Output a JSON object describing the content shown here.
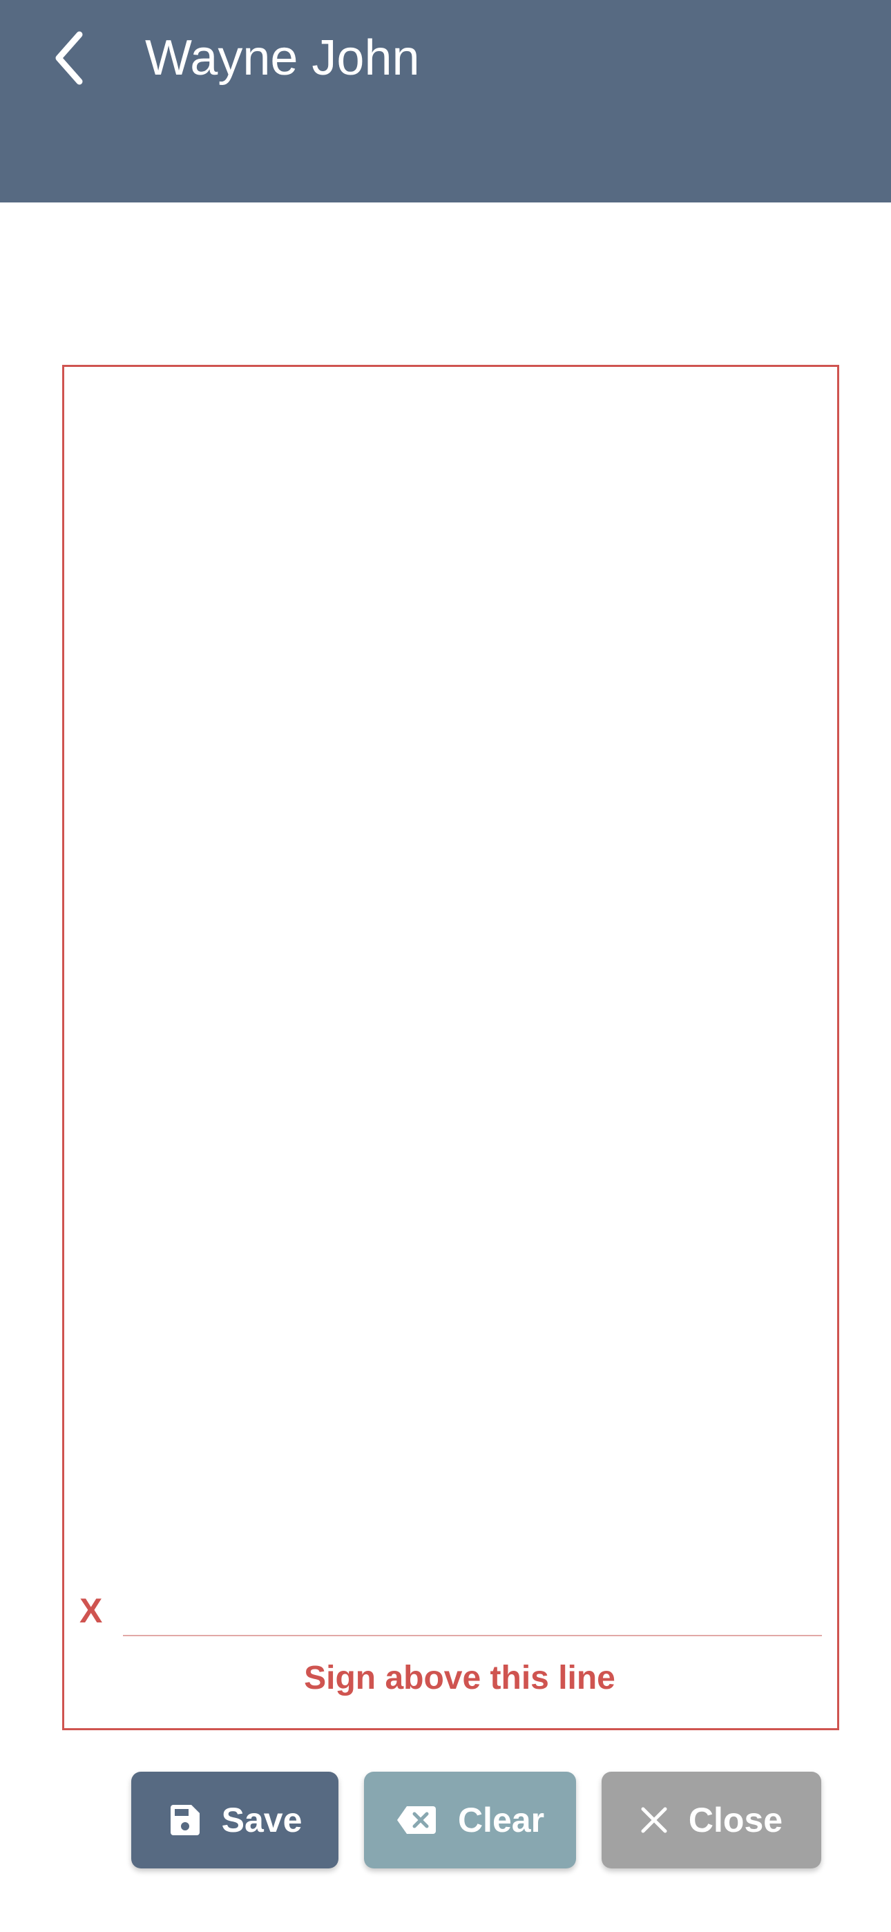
{
  "header": {
    "title": "Wayne John",
    "back_icon": "chevron-left-icon",
    "background_color": "#576a82"
  },
  "signature": {
    "x_mark": "X",
    "caption": "Sign above this line",
    "accent_color": "#cf5450"
  },
  "buttons": {
    "save": {
      "label": "Save",
      "icon": "floppy-disk-icon",
      "color": "#576a82"
    },
    "clear": {
      "label": "Clear",
      "icon": "backspace-icon",
      "color": "#88a7b0"
    },
    "close": {
      "label": "Close",
      "icon": "close-icon",
      "color": "#a2a2a2"
    }
  }
}
